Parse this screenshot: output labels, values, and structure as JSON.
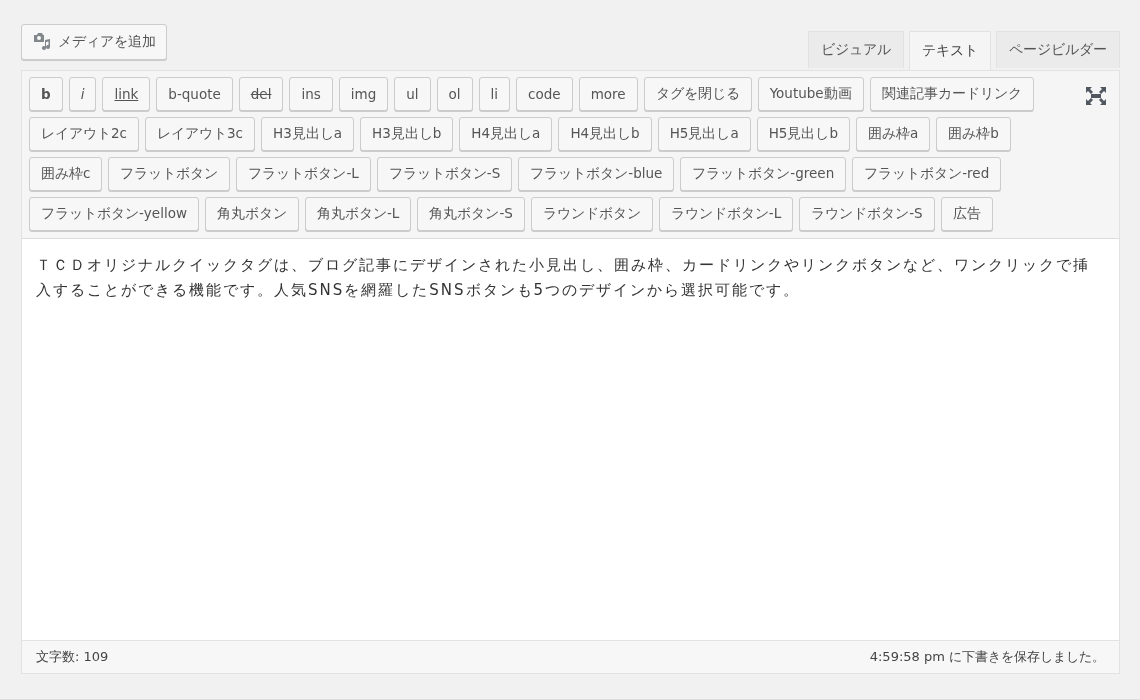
{
  "media_button": {
    "label": "メディアを追加"
  },
  "tabs": [
    {
      "label": "ビジュアル",
      "selected": false
    },
    {
      "label": "テキスト",
      "selected": true
    },
    {
      "label": "ページビルダー",
      "selected": false
    }
  ],
  "quicktags": [
    {
      "label": "b",
      "kind": "bold"
    },
    {
      "label": "i",
      "kind": "italic"
    },
    {
      "label": "link",
      "kind": "link"
    },
    {
      "label": "b-quote",
      "kind": "plain"
    },
    {
      "label": "del",
      "kind": "strike"
    },
    {
      "label": "ins",
      "kind": "plain"
    },
    {
      "label": "img",
      "kind": "plain"
    },
    {
      "label": "ul",
      "kind": "plain"
    },
    {
      "label": "ol",
      "kind": "plain"
    },
    {
      "label": "li",
      "kind": "plain"
    },
    {
      "label": "code",
      "kind": "plain"
    },
    {
      "label": "more",
      "kind": "plain"
    },
    {
      "label": "タグを閉じる",
      "kind": "plain"
    },
    {
      "label": "Youtube動画",
      "kind": "plain"
    },
    {
      "label": "関連記事カードリンク",
      "kind": "plain"
    },
    {
      "label": "レイアウト2c",
      "kind": "plain"
    },
    {
      "label": "レイアウト3c",
      "kind": "plain"
    },
    {
      "label": "H3見出しa",
      "kind": "plain"
    },
    {
      "label": "H3見出しb",
      "kind": "plain"
    },
    {
      "label": "H4見出しa",
      "kind": "plain"
    },
    {
      "label": "H4見出しb",
      "kind": "plain"
    },
    {
      "label": "H5見出しa",
      "kind": "plain"
    },
    {
      "label": "H5見出しb",
      "kind": "plain"
    },
    {
      "label": "囲み枠a",
      "kind": "plain"
    },
    {
      "label": "囲み枠b",
      "kind": "plain"
    },
    {
      "label": "囲み枠c",
      "kind": "plain"
    },
    {
      "label": "フラットボタン",
      "kind": "plain"
    },
    {
      "label": "フラットボタン-L",
      "kind": "plain"
    },
    {
      "label": "フラットボタン-S",
      "kind": "plain"
    },
    {
      "label": "フラットボタン-blue",
      "kind": "plain"
    },
    {
      "label": "フラットボタン-green",
      "kind": "plain"
    },
    {
      "label": "フラットボタン-red",
      "kind": "plain"
    },
    {
      "label": "フラットボタン-yellow",
      "kind": "plain"
    },
    {
      "label": "角丸ボタン",
      "kind": "plain"
    },
    {
      "label": "角丸ボタン-L",
      "kind": "plain"
    },
    {
      "label": "角丸ボタン-S",
      "kind": "plain"
    },
    {
      "label": "ラウンドボタン",
      "kind": "plain"
    },
    {
      "label": "ラウンドボタン-L",
      "kind": "plain"
    },
    {
      "label": "ラウンドボタン-S",
      "kind": "plain"
    },
    {
      "label": "広告",
      "kind": "plain"
    }
  ],
  "editor": {
    "value": "ＴＣＤオリジナルクイックタグは、ブログ記事にデザインされた小見出し、囲み枠、カードリンクやリンクボタンなど、ワンクリックで挿入することができる機能です。人気SNSを網羅したSNSボタンも5つのデザインから選択可能です。"
  },
  "status_bar": {
    "word_count": "文字数: 109",
    "autosave": "4:59:58 pm に下書きを保存しました。"
  }
}
